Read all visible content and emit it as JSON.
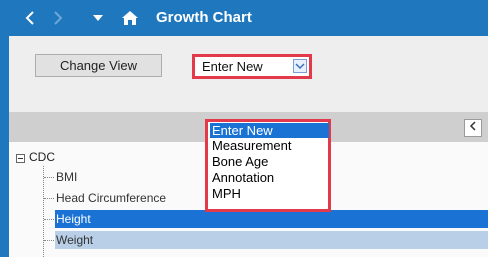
{
  "titlebar": {
    "title": "Growth Chart",
    "back_icon": "chevron-left-icon",
    "forward_icon": "chevron-right-icon",
    "dropdown_icon": "caret-down-icon",
    "home_icon": "home-icon",
    "color": "#1f77be"
  },
  "toolbar": {
    "change_view_label": "Change View",
    "combo_value": "Enter New",
    "combo_arrow_icon": "chevron-down-icon"
  },
  "dropdown": {
    "items": [
      "Enter New",
      "Measurement",
      "Bone Age",
      "Annotation",
      "MPH"
    ],
    "selected_index": 0,
    "highlight_color": "#e23a4a"
  },
  "grid": {
    "collapse_icon": "chevron-left-icon"
  },
  "tree": {
    "root": "CDC",
    "children": [
      "BMI",
      "Head Circumference",
      "Height",
      "Weight"
    ],
    "selected": "Height",
    "secondary_selected": "Weight",
    "selection_color": "#1a73d4"
  }
}
